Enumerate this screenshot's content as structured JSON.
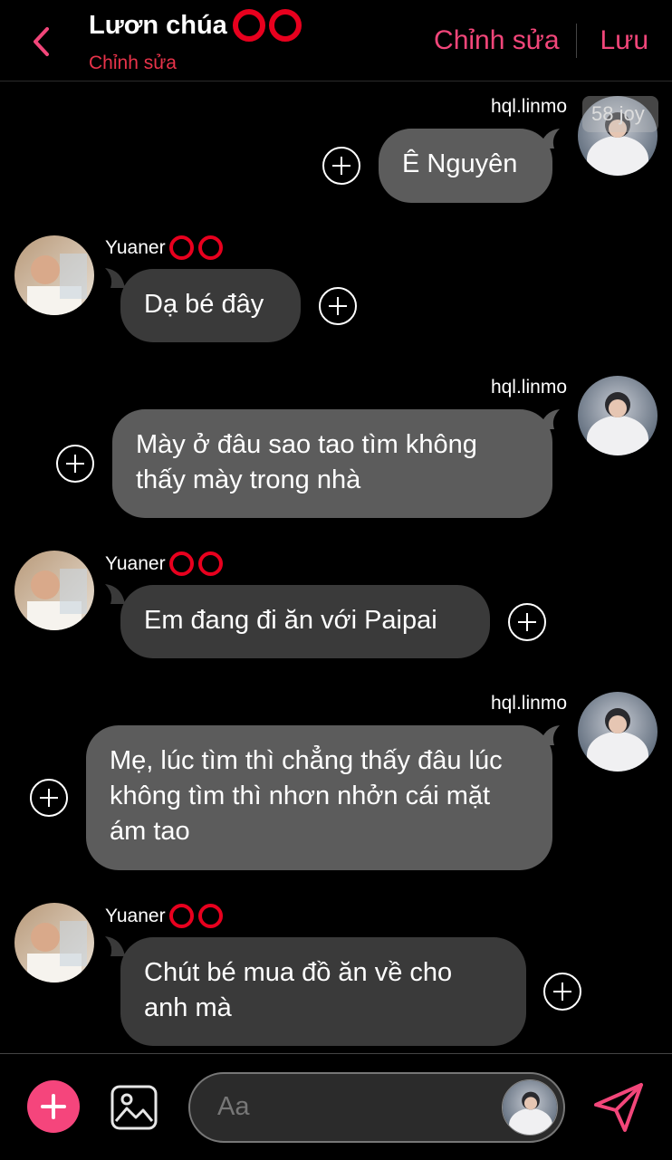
{
  "header": {
    "title": "Lươn chúa",
    "subtitle": "Chỉnh sửa",
    "edit_label": "Chỉnh sửa",
    "save_label": "Lưu",
    "accent_color": "#f2467a",
    "ring_color": "#e8001e"
  },
  "messages": [
    {
      "sender": "hql.linmo",
      "side": "right",
      "text": "Ê Nguyên",
      "badge": "58 joy"
    },
    {
      "sender": "Yuaner",
      "side": "left",
      "text": "Dạ bé đây"
    },
    {
      "sender": "hql.linmo",
      "side": "right",
      "text": "Mày ở đâu sao tao tìm không thấy mày trong nhà"
    },
    {
      "sender": "Yuaner",
      "side": "left",
      "text": "Em đang đi ăn với Paipai"
    },
    {
      "sender": "hql.linmo",
      "side": "right",
      "text": "Mẹ, lúc tìm thì chẳng thấy đâu lúc không tìm thì nhơn nhởn cái mặt ám tao"
    },
    {
      "sender": "Yuaner",
      "side": "left",
      "text": "Chút bé mua đồ ăn về cho anh mà"
    }
  ],
  "composer": {
    "placeholder": "Aa",
    "icons": [
      "add-icon",
      "gallery-icon",
      "send-icon"
    ]
  }
}
